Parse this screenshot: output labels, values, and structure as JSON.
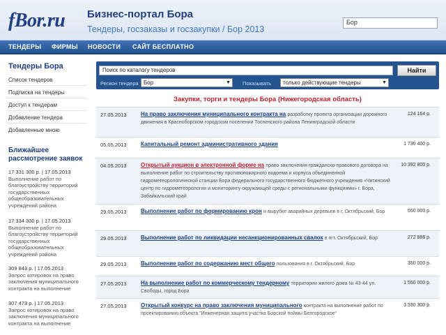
{
  "header": {
    "logo": "fBor.ru",
    "title": "Бизнес-портал Бора",
    "subtitle": "Тендеры, госзаказы и госзакупки / Бор 2013",
    "city_value": "Бор"
  },
  "nav": [
    {
      "label": "ТЕНДЕРЫ"
    },
    {
      "label": "ФИРМЫ"
    },
    {
      "label": "НОВОСТИ"
    },
    {
      "label": "САЙТ БЕСПЛАТНО"
    }
  ],
  "sidebar": {
    "heading": "Тендеры Бора",
    "links": [
      {
        "label": "Список тендеров"
      },
      {
        "label": "Подписка на тендеры"
      },
      {
        "label": "Доступ к тендерам"
      },
      {
        "label": "Добавление тендера"
      },
      {
        "label": "Добавленные мною"
      }
    ],
    "nearest_heading": "Ближайшее рассмотрение заявок",
    "nearest": [
      {
        "date": "17 331 300 р. | 17.05.2013",
        "text": "Выполнение работ по благоустройству территорий государственных общеобразовательных учреждений района"
      },
      {
        "date": "17 334 300 р. | 17.05.2013",
        "text": "Выполнение работ по благоустройству территорий государственных общеобразовательных учреждений района"
      },
      {
        "date": "309 843 р. | 17.05.2013",
        "text": "Запрос котировок на право заключения муниципального контракта на выполнение"
      },
      {
        "date": "307 473 р. | 17.05.2013",
        "text": "Запрос котировок на право заключения муниципального контракта на выполнение"
      }
    ]
  },
  "search": {
    "value": "Поиск по каталогу тендеров",
    "button": "Найти",
    "region_label": "Регион тендера",
    "region_value": "Бор",
    "show_label": "Показывать",
    "show_value": "только действующие тендеры"
  },
  "main_title": "Закупки, торги и тендеры Бора (Нижегородская область)",
  "tenders": [
    {
      "date": "27.05.2013",
      "title": "На право заключения муниципального контракта на",
      "rest": "разработку проекта организации дорожного движения в Красноборском городском поселении Тосненского района Ленинградской области",
      "price": "124 164 р.",
      "red": false
    },
    {
      "date": "05.05.2013",
      "title": "Капитальный ремонт административного здания",
      "rest": "",
      "price": "1 730 400 р.",
      "red": false
    },
    {
      "date": "04.05.2013",
      "title": "Открытый аукцион в электронной форме на",
      "rest": "право заключения гражданско-правового договора на выполнение работ по строительству противопожарного водоема и корпуса объединенной гидрометеорологической станции Бора федерального государственного бюджетного учреждения «Читинский центр по гидрометеорологии и мониторингу окружающей среды с региональными функциями» г. Бора, Забайкальский край",
      "price": "10 392 800 р.",
      "red": true
    },
    {
      "date": "29.05.2013",
      "title": "Выполнение работ по формированию крон",
      "rest": "и вырубке аварийных деревьев в г. Октябрьский, Бор",
      "price": "550 000 р.",
      "red": false
    },
    {
      "date": "29.05.2013",
      "title": "Выполнение работ по ликвидации несанкционированных свалок",
      "rest": "в пгт. Октябрьский, Бор",
      "price": "272 886 р.",
      "red": false
    },
    {
      "date": "29.05.2013",
      "title": "Выполнение работ по содержанию мест общего",
      "rest": "пользования в г. Октябрьский, Бор",
      "price": "350 000 р.",
      "red": false
    },
    {
      "date": "27.05.2013",
      "title": "На выполнение работ по коммерческому тендерному",
      "rest": "территории жилого дома № 43-44 ул. Свободы, город Бора",
      "price": "1 550 000 р.",
      "red": false
    },
    {
      "date": "27.05.2013",
      "title": "Открытый конкурс на право заключения муниципального",
      "rest": "контракта на выполнение работ по проектированию объекта \"Инженерная защита участка Борской поймы Белгородское\"",
      "price": "3 530 300 р.",
      "red": false
    }
  ],
  "colors": {
    "nav_bg": "#24548f",
    "accent_title": "#1f3f87",
    "alert_red": "#c8202a",
    "link_blue": "#3c78c8"
  }
}
